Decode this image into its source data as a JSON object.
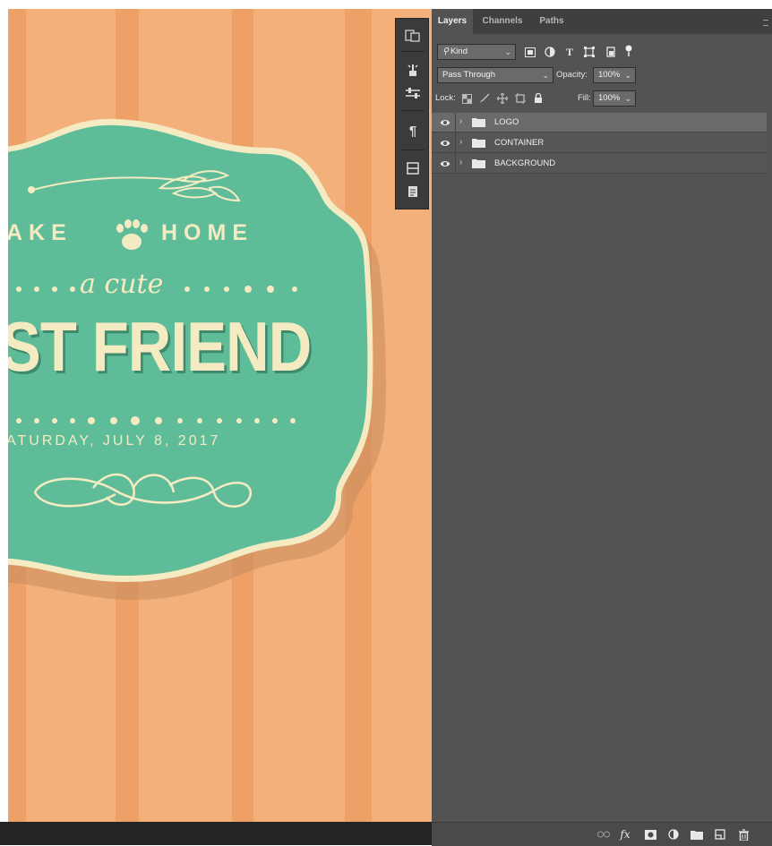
{
  "canvas": {
    "stamp": {
      "line1": "AKE",
      "line1b": "HOME",
      "script": "a cute",
      "headline": "ST FRIEND",
      "date": "ATURDAY, JULY 8, 2017"
    }
  },
  "tools": {
    "items": [
      "history-icon",
      "brush-presets-icon",
      "adjustments-icon",
      "paragraph-icon",
      "navigator-icon",
      "notes-icon"
    ]
  },
  "panel": {
    "tabs": [
      {
        "label": "Layers",
        "active": true
      },
      {
        "label": "Channels",
        "active": false
      },
      {
        "label": "Paths",
        "active": false
      }
    ],
    "filter": {
      "kind_label": "Kind"
    },
    "blend": {
      "mode": "Pass Through",
      "opacity_label": "Opacity:",
      "opacity_value": "100%"
    },
    "lock": {
      "label": "Lock:",
      "fill_label": "Fill:",
      "fill_value": "100%"
    },
    "layers": [
      {
        "name": "LOGO",
        "selected": true
      },
      {
        "name": "CONTAINER",
        "selected": false
      },
      {
        "name": "BACKGROUND",
        "selected": false
      }
    ],
    "footer_icons": [
      "link-layers-icon",
      "fx-icon",
      "add-mask-icon",
      "adjustment-layer-icon",
      "new-group-icon",
      "new-layer-icon",
      "delete-icon"
    ],
    "fx_label": "fx"
  },
  "colors": {
    "canvas_orange": "#f3b07a",
    "stripe_orange": "#eea166",
    "badge_teal": "#5ebd98",
    "cream": "#f4ebc3",
    "panel_gray": "#535353"
  }
}
